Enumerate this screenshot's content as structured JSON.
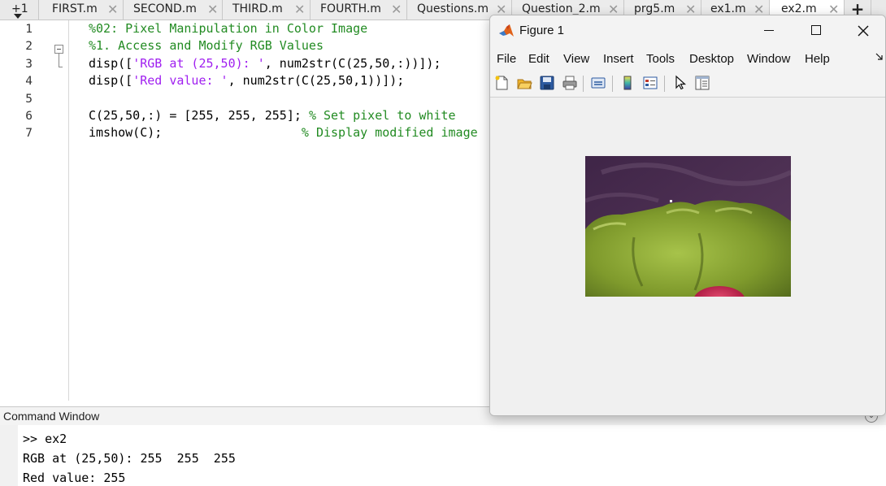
{
  "tabs": {
    "more_label": "+1",
    "items": [
      {
        "label": "FIRST.m"
      },
      {
        "label": "SECOND.m"
      },
      {
        "label": "THIRD.m"
      },
      {
        "label": "FOURTH.m"
      },
      {
        "label": "Questions.m"
      },
      {
        "label": "Question_2.m"
      },
      {
        "label": "prg5.m"
      },
      {
        "label": "ex1.m"
      },
      {
        "label": "ex2.m",
        "active": true
      }
    ],
    "add_label": "+"
  },
  "editor": {
    "line_numbers": [
      "1",
      "2",
      "3",
      "4",
      "5",
      "6",
      "7"
    ],
    "lines": [
      [
        {
          "t": "cm",
          "s": "%02: Pixel Manipulation in Color Image"
        }
      ],
      [
        {
          "t": "cm",
          "s": "%1. Access and Modify RGB Values"
        }
      ],
      [
        {
          "t": "tx",
          "s": "disp(["
        },
        {
          "t": "st",
          "s": "'RGB at (25,50): '"
        },
        {
          "t": "tx",
          "s": ", num2str(C(25,50,:))]);"
        }
      ],
      [
        {
          "t": "tx",
          "s": "disp(["
        },
        {
          "t": "st",
          "s": "'Red value: '"
        },
        {
          "t": "tx",
          "s": ", num2str(C(25,50,1))]);"
        }
      ],
      [],
      [
        {
          "t": "tx",
          "s": "C(25,50,:) = [255, 255, 255]; "
        },
        {
          "t": "cm",
          "s": "% Set pixel to white"
        }
      ],
      [
        {
          "t": "tx",
          "s": "imshow(C);                   "
        },
        {
          "t": "cm",
          "s": "% Display modified image"
        }
      ]
    ]
  },
  "command_window": {
    "title": "Command Window",
    "lines": [
      ">> ex2",
      "RGB at (25,50): 255  255  255",
      "Red value: 255"
    ]
  },
  "figure": {
    "title": "Figure 1",
    "menu": [
      "File",
      "Edit",
      "View",
      "Insert",
      "Tools",
      "Desktop",
      "Window",
      "Help"
    ],
    "toolbar_icons": [
      "new-figure-icon",
      "open-file-icon",
      "save-icon",
      "print-icon",
      "link-icon",
      "colorbar-icon",
      "legend-icon",
      "select-pointer-icon",
      "property-inspector-icon"
    ],
    "colors": {
      "eggplant_bg": "#4a2d4f",
      "pepper_green": "#8aa93a",
      "red_pepper": "#c4164a"
    }
  }
}
